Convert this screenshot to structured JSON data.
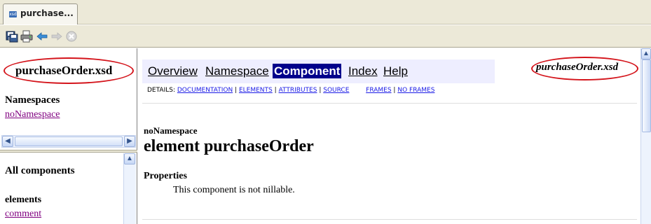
{
  "tab": {
    "label": "purchase...",
    "icon": "xsd-file-icon",
    "icon_text": "xsd"
  },
  "toolbar": {
    "buttons": [
      {
        "icon": "save-icon",
        "enabled": true
      },
      {
        "icon": "print-icon",
        "enabled": true
      },
      {
        "icon": "back-arrow-icon",
        "enabled": true
      },
      {
        "icon": "forward-arrow-icon",
        "enabled": false
      },
      {
        "icon": "stop-icon",
        "enabled": false
      }
    ]
  },
  "left_top": {
    "title": "purchaseOrder.xsd",
    "namespaces_heading": "Namespaces",
    "namespace_link": "noNamespace"
  },
  "left_bottom": {
    "heading": "All components",
    "elements_heading": "elements",
    "element_link": "comment"
  },
  "main": {
    "nav": {
      "overview": "Overview",
      "namespace": "Namespace",
      "component": "Component",
      "index": "Index",
      "help": "Help"
    },
    "details": {
      "prefix": "DETAILS:",
      "documentation": "DOCUMENTATION",
      "elements": "ELEMENTS",
      "attributes": "ATTRIBUTES",
      "source": "SOURCE",
      "frames": "FRAMES",
      "no_frames": "NO FRAMES",
      "separator": "|"
    },
    "site_title": "purchaseOrder.xsd",
    "namespace_label": "noNamespace",
    "element_title": "element purchaseOrder",
    "properties_heading": "Properties",
    "properties_text": "This component is not nillable."
  },
  "colors": {
    "annotation_oval": "#d4141b",
    "nav_background": "#eeeeff",
    "nav_active_bg": "#00008b",
    "visited_link": "#800080",
    "link": "#1a1ae6"
  }
}
